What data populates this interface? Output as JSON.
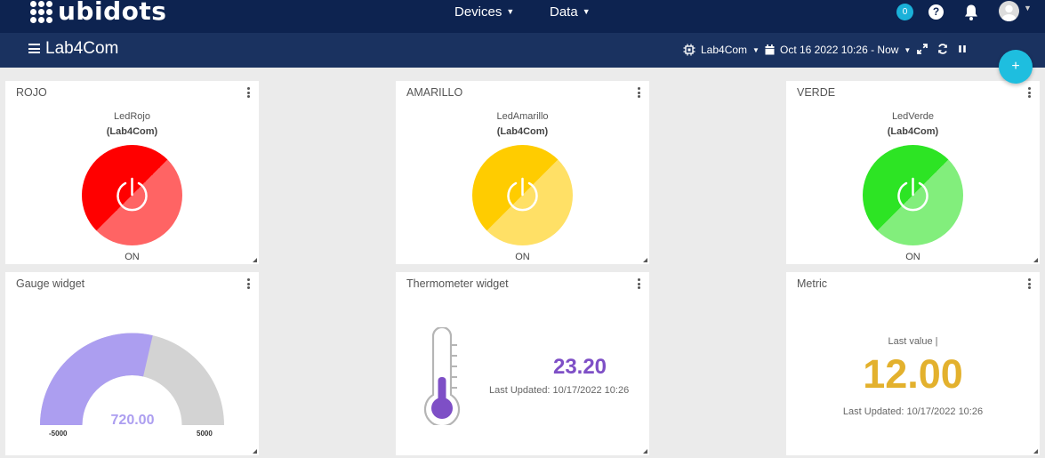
{
  "app": {
    "logo_text": "ubidots"
  },
  "topnav": {
    "devices_label": "Devices",
    "data_label": "Data",
    "notifications_count": "0",
    "help_label": "?"
  },
  "dashbar": {
    "title": "Lab4Com",
    "device_filter": "Lab4Com",
    "date_range": "Oct 16 2022 10:26 - Now"
  },
  "fab_label": "+",
  "widgets": {
    "rojo": {
      "title": "ROJO",
      "variable": "LedRojo",
      "device": "(Lab4Com)",
      "state": "ON",
      "color_light": "#ff6464",
      "color_dark": "#ff0000"
    },
    "amarillo": {
      "title": "AMARILLO",
      "variable": "LedAmarillo",
      "device": "(Lab4Com)",
      "state": "ON",
      "color_light": "#ffe066",
      "color_dark": "#ffcc00"
    },
    "verde": {
      "title": "VERDE",
      "variable": "LedVerde",
      "device": "(Lab4Com)",
      "state": "ON",
      "color_light": "#82ee7c",
      "color_dark": "#2de424"
    },
    "gauge": {
      "title": "Gauge widget",
      "value": "720.00",
      "min": "-5000",
      "max": "5000",
      "value_num": 720,
      "min_num": -5000,
      "max_num": 5000,
      "fill_color": "#ac9ef0",
      "track_color": "#d3d3d3"
    },
    "thermometer": {
      "title": "Thermometer widget",
      "value": "23.20",
      "last_updated": "Last Updated: 10/17/2022 10:26",
      "fill_color": "#7e4fc6"
    },
    "metric": {
      "title": "Metric",
      "label": "Last value |",
      "value": "12.00",
      "last_updated": "Last Updated: 10/17/2022 10:26",
      "color": "#e3b12d"
    }
  }
}
